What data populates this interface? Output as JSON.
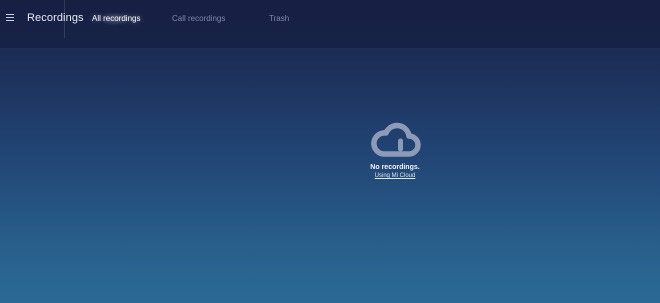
{
  "header": {
    "title": "Recordings",
    "menu_icon": "hamburger-menu-icon",
    "tabs": [
      {
        "label": "All recordings",
        "active": true
      },
      {
        "label": "Call recordings",
        "active": false
      },
      {
        "label": "Trash",
        "active": false
      }
    ]
  },
  "empty_state": {
    "icon": "cloud-icon",
    "message": "No recordings.",
    "link_label": "Using Mi Cloud"
  },
  "colors": {
    "background_top": "#1b2447",
    "background_bottom": "#2b6a95",
    "active_tab_text": "#ffffff",
    "inactive_tab_text": "#7f88a6"
  }
}
